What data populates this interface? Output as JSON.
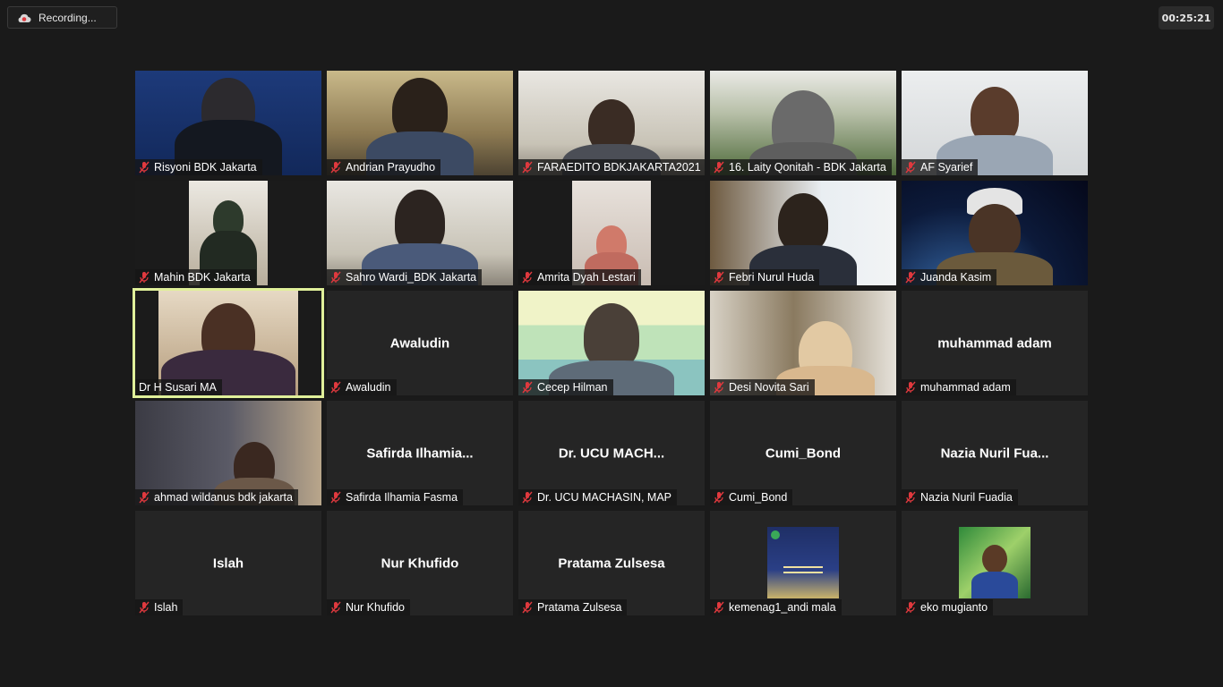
{
  "recording": {
    "label": "Recording..."
  },
  "timer": {
    "value": "00:25:21"
  },
  "colors": {
    "background": "#1a1a1a",
    "tile": "#252525",
    "active_speaker": "#e0f09a",
    "mute": "#e0393e"
  },
  "participants": [
    {
      "name": "Risyoni BDK Jakarta",
      "video": true,
      "muted": true
    },
    {
      "name": "Andrian Prayudho",
      "video": true,
      "muted": true
    },
    {
      "name": "FARAEDITO BDKJAKARTA2021",
      "video": true,
      "muted": true
    },
    {
      "name": "16. Laity Qonitah - BDK Jakarta",
      "video": true,
      "muted": true
    },
    {
      "name": "AF Syarief",
      "video": true,
      "muted": true
    },
    {
      "name": "Mahin BDK Jakarta",
      "video": true,
      "muted": true
    },
    {
      "name": "Sahro Wardi_BDK Jakarta",
      "video": true,
      "muted": true
    },
    {
      "name": "Amrita Dyah Lestari",
      "video": true,
      "muted": true
    },
    {
      "name": "Febri Nurul Huda",
      "video": true,
      "muted": true
    },
    {
      "name": "Juanda Kasim",
      "video": true,
      "muted": true
    },
    {
      "name": "Dr H Susari MA",
      "video": true,
      "muted": false,
      "active": true
    },
    {
      "name": "Awaludin",
      "display": "Awaludin",
      "video": false,
      "muted": true
    },
    {
      "name": "Cecep Hilman",
      "video": true,
      "muted": true
    },
    {
      "name": "Desi Novita Sari",
      "video": true,
      "muted": true
    },
    {
      "name": "muhammad adam",
      "display": "muhammad adam",
      "video": false,
      "muted": true
    },
    {
      "name": "ahmad wildanus bdk jakarta",
      "video": true,
      "muted": true
    },
    {
      "name": "Safirda Ilhamia Fasma",
      "display": "Safirda  Ilhamia...",
      "video": false,
      "muted": true
    },
    {
      "name": "Dr. UCU MACHASIN, MAP",
      "display": "Dr.  UCU  MACH...",
      "video": false,
      "muted": true
    },
    {
      "name": "Cumi_Bond",
      "display": "Cumi_Bond",
      "video": false,
      "muted": true
    },
    {
      "name": "Nazia Nuril Fuadia",
      "display": "Nazia  Nuril  Fua...",
      "video": false,
      "muted": true
    },
    {
      "name": "Islah",
      "display": "Islah",
      "video": false,
      "muted": true
    },
    {
      "name": "Nur Khufido",
      "display": "Nur Khufido",
      "video": false,
      "muted": true
    },
    {
      "name": "Pratama Zulsesa",
      "display": "Pratama Zulsesa",
      "video": false,
      "muted": true
    },
    {
      "name": "kemenag1_andi mala",
      "video": false,
      "picture": true,
      "muted": true
    },
    {
      "name": "eko mugianto",
      "video": false,
      "picture": true,
      "muted": true
    }
  ]
}
